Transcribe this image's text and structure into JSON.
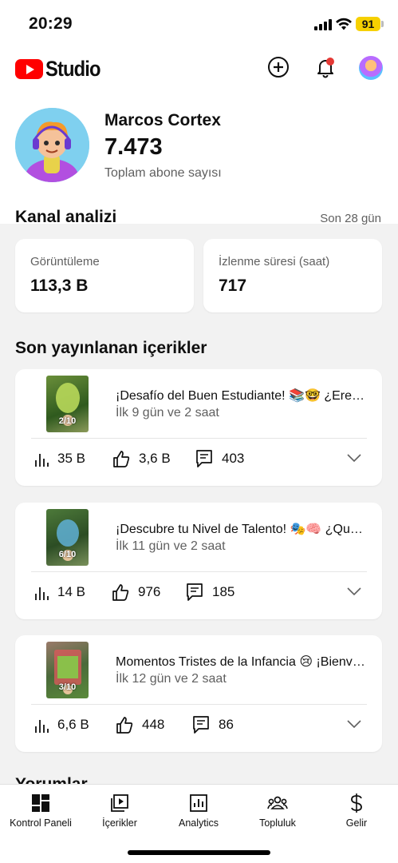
{
  "status_bar": {
    "time": "20:29",
    "battery": "91"
  },
  "header": {
    "logo_text": "Studio"
  },
  "channel": {
    "name": "Marcos Cortex",
    "subscribers": "7.473",
    "subscribers_label": "Toplam abone sayısı"
  },
  "analytics": {
    "title": "Kanal analizi",
    "period": "Son 28 gün",
    "cards": [
      {
        "label": "Görüntüleme",
        "value": "113,3 B"
      },
      {
        "label": "İzlenme süresi (saat)",
        "value": "717"
      }
    ]
  },
  "recent": {
    "title": "Son yayınlanan içerikler",
    "items": [
      {
        "title": "¡Desafío del Buen Estudiante! 📚🤓 ¿Eres el mejor alumno?",
        "age": "İlk 9 gün ve 2 saat",
        "views": "35 B",
        "likes": "3,6 B",
        "comments": "403",
        "thumb_label": "2/10"
      },
      {
        "title": "¡Descubre tu Nivel de Talento! 🎭🧠 ¿Qué tan talentoso eres?",
        "age": "İlk 11 gün ve 2 saat",
        "views": "14 B",
        "likes": "976",
        "comments": "185",
        "thumb_label": "6/10"
      },
      {
        "title": "Momentos Tristes de la Infancia 😢 ¡Bienvenidos!",
        "age": "İlk 12 gün ve 2 saat",
        "views": "6,6 B",
        "likes": "448",
        "comments": "86",
        "thumb_label": "3/10"
      }
    ]
  },
  "next_section_partial": "Yorumlar",
  "bottom_nav": [
    {
      "label": "Kontrol Paneli",
      "icon": "dashboard-icon"
    },
    {
      "label": "İçerikler",
      "icon": "content-icon"
    },
    {
      "label": "Analytics",
      "icon": "analytics-icon"
    },
    {
      "label": "Topluluk",
      "icon": "community-icon"
    },
    {
      "label": "Gelir",
      "icon": "earn-icon"
    }
  ],
  "colors": {
    "brand": "#ff0000",
    "notification_dot": "#e53935",
    "text_secondary": "#606060",
    "battery": "#f6d000"
  }
}
